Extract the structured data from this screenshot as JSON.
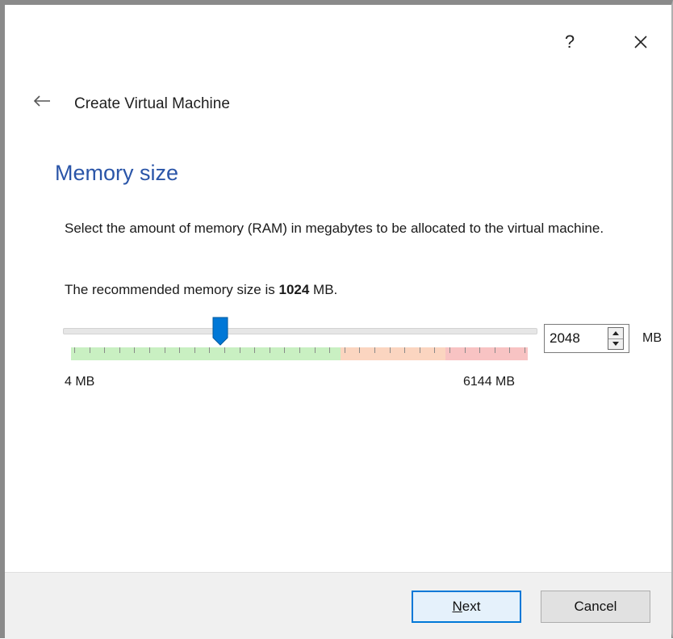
{
  "window": {
    "help_label": "?",
    "close_icon": "close-icon"
  },
  "header": {
    "back_icon": "arrow-left-icon",
    "title": "Create Virtual Machine"
  },
  "page": {
    "section_title": "Memory size",
    "description": "Select the amount of memory (RAM) in megabytes to be allocated to the virtual machine.",
    "recommend_prefix": "The recommended memory size is ",
    "recommend_value": "1024",
    "recommend_suffix": " MB."
  },
  "memory": {
    "value": "2048",
    "unit": "MB",
    "min_label": "4 MB",
    "max_label": "6144 MB",
    "min_value": 4,
    "max_value": 6144,
    "current_value": 2048,
    "green_zone_end_fraction": 0.59,
    "orange_zone_end_fraction": 0.82
  },
  "footer": {
    "next_mnemonic": "N",
    "next_rest": "ext",
    "cancel_label": "Cancel"
  },
  "colors": {
    "section_title": "#2a55a8",
    "slider_handle": "#0078d7",
    "zone_green": "#c9f0c2",
    "zone_orange": "#fbd5c0",
    "zone_red": "#f8c3c3",
    "default_button_border": "#0078d7"
  }
}
